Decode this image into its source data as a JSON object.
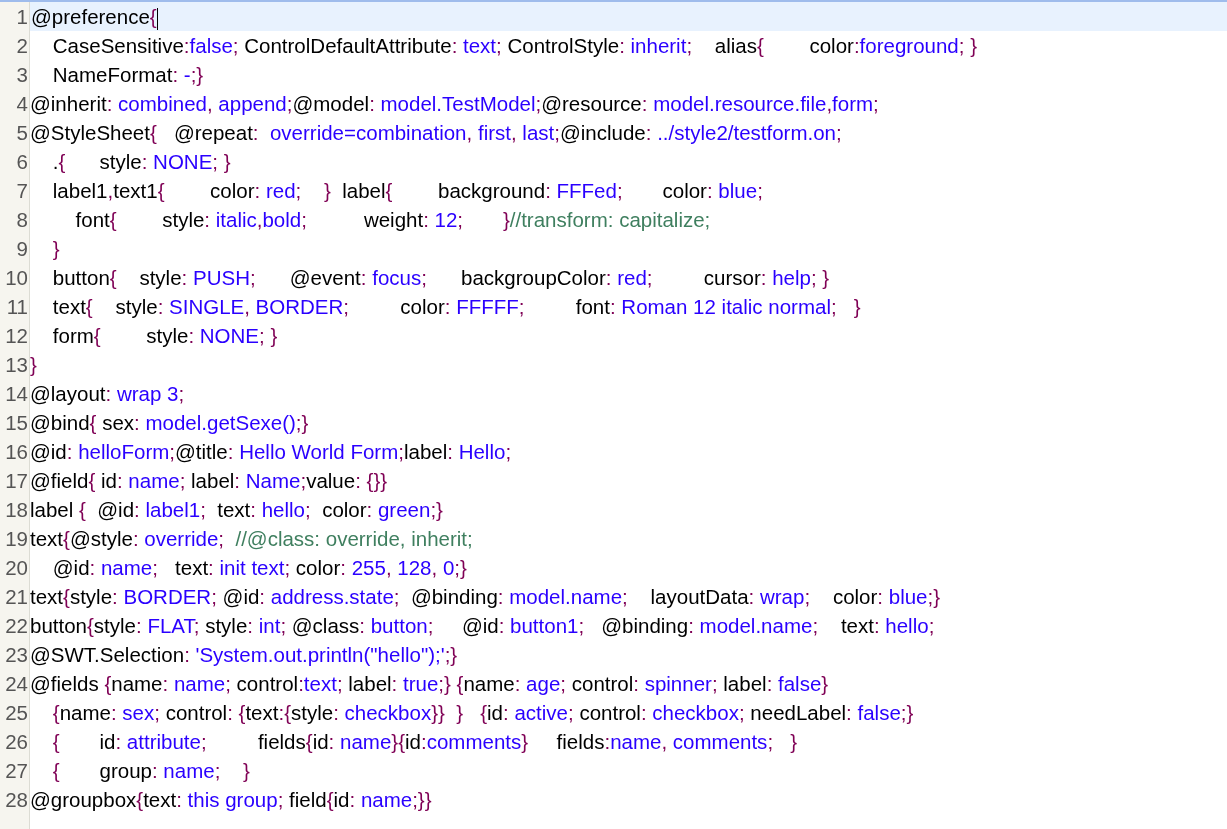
{
  "editor": {
    "lines": [
      {
        "number": "1",
        "current": true,
        "tokens": [
          {
            "kind": "plain",
            "text": "@preference"
          },
          {
            "kind": "punct",
            "text": "{"
          }
        ]
      },
      {
        "number": "2",
        "current": false,
        "tokens": [
          {
            "kind": "plain",
            "text": "    CaseSensitive"
          },
          {
            "kind": "punct",
            "text": ":"
          },
          {
            "kind": "value",
            "text": "false"
          },
          {
            "kind": "punct",
            "text": ";"
          },
          {
            "kind": "plain",
            "text": " ControlDefaultAttribute"
          },
          {
            "kind": "punct",
            "text": ":"
          },
          {
            "kind": "value",
            "text": " text"
          },
          {
            "kind": "punct",
            "text": ";"
          },
          {
            "kind": "plain",
            "text": " ControlStyle"
          },
          {
            "kind": "punct",
            "text": ":"
          },
          {
            "kind": "value",
            "text": " inherit"
          },
          {
            "kind": "punct",
            "text": ";"
          },
          {
            "kind": "plain",
            "text": "    alias"
          },
          {
            "kind": "punct",
            "text": "{"
          },
          {
            "kind": "plain",
            "text": "        color"
          },
          {
            "kind": "punct",
            "text": ":"
          },
          {
            "kind": "value",
            "text": "foreground"
          },
          {
            "kind": "punct",
            "text": "; }"
          }
        ]
      },
      {
        "number": "3",
        "current": false,
        "tokens": [
          {
            "kind": "plain",
            "text": "    NameFormat"
          },
          {
            "kind": "punct",
            "text": ":"
          },
          {
            "kind": "value",
            "text": " -"
          },
          {
            "kind": "punct",
            "text": ";}"
          }
        ]
      },
      {
        "number": "4",
        "current": false,
        "tokens": [
          {
            "kind": "plain",
            "text": "@inherit"
          },
          {
            "kind": "punct",
            "text": ":"
          },
          {
            "kind": "value",
            "text": " combined"
          },
          {
            "kind": "punct",
            "text": ","
          },
          {
            "kind": "value",
            "text": " append"
          },
          {
            "kind": "punct",
            "text": ";"
          },
          {
            "kind": "plain",
            "text": "@model"
          },
          {
            "kind": "punct",
            "text": ":"
          },
          {
            "kind": "value",
            "text": " model.TestModel"
          },
          {
            "kind": "punct",
            "text": ";"
          },
          {
            "kind": "plain",
            "text": "@resource"
          },
          {
            "kind": "punct",
            "text": ":"
          },
          {
            "kind": "value",
            "text": " model.resource.file"
          },
          {
            "kind": "punct",
            "text": ","
          },
          {
            "kind": "value",
            "text": "form"
          },
          {
            "kind": "punct",
            "text": ";"
          }
        ]
      },
      {
        "number": "5",
        "current": false,
        "tokens": [
          {
            "kind": "plain",
            "text": "@StyleSheet"
          },
          {
            "kind": "punct",
            "text": "{"
          },
          {
            "kind": "plain",
            "text": "   @repeat"
          },
          {
            "kind": "punct",
            "text": ":"
          },
          {
            "kind": "value",
            "text": "  override=combination"
          },
          {
            "kind": "punct",
            "text": ","
          },
          {
            "kind": "value",
            "text": " first"
          },
          {
            "kind": "punct",
            "text": ","
          },
          {
            "kind": "value",
            "text": " last"
          },
          {
            "kind": "punct",
            "text": ";"
          },
          {
            "kind": "plain",
            "text": "@include"
          },
          {
            "kind": "punct",
            "text": ":"
          },
          {
            "kind": "value",
            "text": " ../style2/testform.on"
          },
          {
            "kind": "punct",
            "text": ";"
          }
        ]
      },
      {
        "number": "6",
        "current": false,
        "tokens": [
          {
            "kind": "plain",
            "text": "    ."
          },
          {
            "kind": "punct",
            "text": "{"
          },
          {
            "kind": "plain",
            "text": "      style"
          },
          {
            "kind": "punct",
            "text": ":"
          },
          {
            "kind": "value",
            "text": " NONE"
          },
          {
            "kind": "punct",
            "text": "; }"
          }
        ]
      },
      {
        "number": "7",
        "current": false,
        "tokens": [
          {
            "kind": "plain",
            "text": "    label1"
          },
          {
            "kind": "punct",
            "text": ","
          },
          {
            "kind": "plain",
            "text": "text1"
          },
          {
            "kind": "punct",
            "text": "{"
          },
          {
            "kind": "plain",
            "text": "        color"
          },
          {
            "kind": "punct",
            "text": ":"
          },
          {
            "kind": "value",
            "text": " red"
          },
          {
            "kind": "punct",
            "text": ";    }"
          },
          {
            "kind": "plain",
            "text": "  label"
          },
          {
            "kind": "punct",
            "text": "{"
          },
          {
            "kind": "plain",
            "text": "        background"
          },
          {
            "kind": "punct",
            "text": ":"
          },
          {
            "kind": "value",
            "text": " FFFed"
          },
          {
            "kind": "punct",
            "text": ";"
          },
          {
            "kind": "plain",
            "text": "       color"
          },
          {
            "kind": "punct",
            "text": ":"
          },
          {
            "kind": "value",
            "text": " blue"
          },
          {
            "kind": "punct",
            "text": ";"
          }
        ]
      },
      {
        "number": "8",
        "current": false,
        "tokens": [
          {
            "kind": "plain",
            "text": "        font"
          },
          {
            "kind": "punct",
            "text": "{"
          },
          {
            "kind": "plain",
            "text": "        style"
          },
          {
            "kind": "punct",
            "text": ":"
          },
          {
            "kind": "value",
            "text": " italic"
          },
          {
            "kind": "punct",
            "text": ","
          },
          {
            "kind": "value",
            "text": "bold"
          },
          {
            "kind": "punct",
            "text": ";"
          },
          {
            "kind": "plain",
            "text": "          weight"
          },
          {
            "kind": "punct",
            "text": ":"
          },
          {
            "kind": "value",
            "text": " 12"
          },
          {
            "kind": "punct",
            "text": ";       }"
          },
          {
            "kind": "comment",
            "text": "//transform: capitalize;"
          }
        ]
      },
      {
        "number": "9",
        "current": false,
        "tokens": [
          {
            "kind": "punct",
            "text": "    }"
          }
        ]
      },
      {
        "number": "10",
        "current": false,
        "tokens": [
          {
            "kind": "plain",
            "text": "    button"
          },
          {
            "kind": "punct",
            "text": "{"
          },
          {
            "kind": "plain",
            "text": "    style"
          },
          {
            "kind": "punct",
            "text": ":"
          },
          {
            "kind": "value",
            "text": " PUSH"
          },
          {
            "kind": "punct",
            "text": ";"
          },
          {
            "kind": "plain",
            "text": "      @event"
          },
          {
            "kind": "punct",
            "text": ":"
          },
          {
            "kind": "value",
            "text": " focus"
          },
          {
            "kind": "punct",
            "text": ";"
          },
          {
            "kind": "plain",
            "text": "      backgroupColor"
          },
          {
            "kind": "punct",
            "text": ":"
          },
          {
            "kind": "value",
            "text": " red"
          },
          {
            "kind": "punct",
            "text": ";"
          },
          {
            "kind": "plain",
            "text": "         cursor"
          },
          {
            "kind": "punct",
            "text": ":"
          },
          {
            "kind": "value",
            "text": " help"
          },
          {
            "kind": "punct",
            "text": "; }"
          }
        ]
      },
      {
        "number": "11",
        "current": false,
        "tokens": [
          {
            "kind": "plain",
            "text": "    text"
          },
          {
            "kind": "punct",
            "text": "{"
          },
          {
            "kind": "plain",
            "text": "    style"
          },
          {
            "kind": "punct",
            "text": ":"
          },
          {
            "kind": "value",
            "text": " SINGLE"
          },
          {
            "kind": "punct",
            "text": ","
          },
          {
            "kind": "value",
            "text": " BORDER"
          },
          {
            "kind": "punct",
            "text": ";"
          },
          {
            "kind": "plain",
            "text": "         color"
          },
          {
            "kind": "punct",
            "text": ":"
          },
          {
            "kind": "value",
            "text": " FFFFF"
          },
          {
            "kind": "punct",
            "text": ";"
          },
          {
            "kind": "plain",
            "text": "         font"
          },
          {
            "kind": "punct",
            "text": ":"
          },
          {
            "kind": "value",
            "text": " Roman 12 italic normal"
          },
          {
            "kind": "punct",
            "text": ";   }"
          }
        ]
      },
      {
        "number": "12",
        "current": false,
        "tokens": [
          {
            "kind": "plain",
            "text": "    form"
          },
          {
            "kind": "punct",
            "text": "{"
          },
          {
            "kind": "plain",
            "text": "        style"
          },
          {
            "kind": "punct",
            "text": ":"
          },
          {
            "kind": "value",
            "text": " NONE"
          },
          {
            "kind": "punct",
            "text": "; }"
          }
        ]
      },
      {
        "number": "13",
        "current": false,
        "tokens": [
          {
            "kind": "punct",
            "text": "}"
          }
        ]
      },
      {
        "number": "14",
        "current": false,
        "tokens": [
          {
            "kind": "plain",
            "text": "@layout"
          },
          {
            "kind": "punct",
            "text": ":"
          },
          {
            "kind": "value",
            "text": " wrap 3"
          },
          {
            "kind": "punct",
            "text": ";"
          }
        ]
      },
      {
        "number": "15",
        "current": false,
        "tokens": [
          {
            "kind": "plain",
            "text": "@bind"
          },
          {
            "kind": "punct",
            "text": "{"
          },
          {
            "kind": "plain",
            "text": " sex"
          },
          {
            "kind": "punct",
            "text": ":"
          },
          {
            "kind": "value",
            "text": " model.getSexe()"
          },
          {
            "kind": "punct",
            "text": ";}"
          }
        ]
      },
      {
        "number": "16",
        "current": false,
        "tokens": [
          {
            "kind": "plain",
            "text": "@id"
          },
          {
            "kind": "punct",
            "text": ":"
          },
          {
            "kind": "value",
            "text": " helloForm"
          },
          {
            "kind": "punct",
            "text": ";"
          },
          {
            "kind": "plain",
            "text": "@title"
          },
          {
            "kind": "punct",
            "text": ":"
          },
          {
            "kind": "value",
            "text": " Hello World Form"
          },
          {
            "kind": "punct",
            "text": ";"
          },
          {
            "kind": "plain",
            "text": "label"
          },
          {
            "kind": "punct",
            "text": ":"
          },
          {
            "kind": "value",
            "text": " Hello"
          },
          {
            "kind": "punct",
            "text": ";"
          }
        ]
      },
      {
        "number": "17",
        "current": false,
        "tokens": [
          {
            "kind": "plain",
            "text": "@field"
          },
          {
            "kind": "punct",
            "text": "{"
          },
          {
            "kind": "plain",
            "text": " id"
          },
          {
            "kind": "punct",
            "text": ":"
          },
          {
            "kind": "value",
            "text": " name"
          },
          {
            "kind": "punct",
            "text": ";"
          },
          {
            "kind": "plain",
            "text": " label"
          },
          {
            "kind": "punct",
            "text": ":"
          },
          {
            "kind": "value",
            "text": " Name"
          },
          {
            "kind": "punct",
            "text": ";"
          },
          {
            "kind": "plain",
            "text": "value"
          },
          {
            "kind": "punct",
            "text": ": {}}"
          }
        ]
      },
      {
        "number": "18",
        "current": false,
        "tokens": [
          {
            "kind": "plain",
            "text": "label "
          },
          {
            "kind": "punct",
            "text": "{"
          },
          {
            "kind": "plain",
            "text": "  @id"
          },
          {
            "kind": "punct",
            "text": ":"
          },
          {
            "kind": "value",
            "text": " label1"
          },
          {
            "kind": "punct",
            "text": ";"
          },
          {
            "kind": "plain",
            "text": "  text"
          },
          {
            "kind": "punct",
            "text": ":"
          },
          {
            "kind": "value",
            "text": " hello"
          },
          {
            "kind": "punct",
            "text": ";"
          },
          {
            "kind": "plain",
            "text": "  color"
          },
          {
            "kind": "punct",
            "text": ":"
          },
          {
            "kind": "value",
            "text": " green"
          },
          {
            "kind": "punct",
            "text": ";}"
          }
        ]
      },
      {
        "number": "19",
        "current": false,
        "tokens": [
          {
            "kind": "plain",
            "text": "text"
          },
          {
            "kind": "punct",
            "text": "{"
          },
          {
            "kind": "plain",
            "text": "@style"
          },
          {
            "kind": "punct",
            "text": ":"
          },
          {
            "kind": "value",
            "text": " override"
          },
          {
            "kind": "punct",
            "text": ";"
          },
          {
            "kind": "comment",
            "text": "  //@class: override, inherit;"
          }
        ]
      },
      {
        "number": "20",
        "current": false,
        "tokens": [
          {
            "kind": "plain",
            "text": "    @id"
          },
          {
            "kind": "punct",
            "text": ":"
          },
          {
            "kind": "value",
            "text": " name"
          },
          {
            "kind": "punct",
            "text": ";"
          },
          {
            "kind": "plain",
            "text": "   text"
          },
          {
            "kind": "punct",
            "text": ":"
          },
          {
            "kind": "value",
            "text": " init text"
          },
          {
            "kind": "punct",
            "text": ";"
          },
          {
            "kind": "plain",
            "text": " color"
          },
          {
            "kind": "punct",
            "text": ":"
          },
          {
            "kind": "value",
            "text": " 255"
          },
          {
            "kind": "punct",
            "text": ","
          },
          {
            "kind": "value",
            "text": " 128"
          },
          {
            "kind": "punct",
            "text": ","
          },
          {
            "kind": "value",
            "text": " 0"
          },
          {
            "kind": "punct",
            "text": ";}"
          }
        ]
      },
      {
        "number": "21",
        "current": false,
        "tokens": [
          {
            "kind": "plain",
            "text": "text"
          },
          {
            "kind": "punct",
            "text": "{"
          },
          {
            "kind": "plain",
            "text": "style"
          },
          {
            "kind": "punct",
            "text": ":"
          },
          {
            "kind": "value",
            "text": " BORDER"
          },
          {
            "kind": "punct",
            "text": ";"
          },
          {
            "kind": "plain",
            "text": " @id"
          },
          {
            "kind": "punct",
            "text": ":"
          },
          {
            "kind": "value",
            "text": " address.state"
          },
          {
            "kind": "punct",
            "text": ";"
          },
          {
            "kind": "plain",
            "text": "  @binding"
          },
          {
            "kind": "punct",
            "text": ":"
          },
          {
            "kind": "value",
            "text": " model.name"
          },
          {
            "kind": "punct",
            "text": ";"
          },
          {
            "kind": "plain",
            "text": "    layoutData"
          },
          {
            "kind": "punct",
            "text": ":"
          },
          {
            "kind": "value",
            "text": " wrap"
          },
          {
            "kind": "punct",
            "text": ";"
          },
          {
            "kind": "plain",
            "text": "    color"
          },
          {
            "kind": "punct",
            "text": ":"
          },
          {
            "kind": "value",
            "text": " blue"
          },
          {
            "kind": "punct",
            "text": ";}"
          }
        ]
      },
      {
        "number": "22",
        "current": false,
        "tokens": [
          {
            "kind": "plain",
            "text": "button"
          },
          {
            "kind": "punct",
            "text": "{"
          },
          {
            "kind": "plain",
            "text": "style"
          },
          {
            "kind": "punct",
            "text": ":"
          },
          {
            "kind": "value",
            "text": " FLAT"
          },
          {
            "kind": "punct",
            "text": ";"
          },
          {
            "kind": "plain",
            "text": " style"
          },
          {
            "kind": "punct",
            "text": ":"
          },
          {
            "kind": "value",
            "text": " int"
          },
          {
            "kind": "punct",
            "text": ";"
          },
          {
            "kind": "plain",
            "text": " @class"
          },
          {
            "kind": "punct",
            "text": ":"
          },
          {
            "kind": "value",
            "text": " button"
          },
          {
            "kind": "punct",
            "text": ";"
          },
          {
            "kind": "plain",
            "text": "     @id"
          },
          {
            "kind": "punct",
            "text": ":"
          },
          {
            "kind": "value",
            "text": " button1"
          },
          {
            "kind": "punct",
            "text": ";"
          },
          {
            "kind": "plain",
            "text": "   @binding"
          },
          {
            "kind": "punct",
            "text": ":"
          },
          {
            "kind": "value",
            "text": " model.name"
          },
          {
            "kind": "punct",
            "text": ";"
          },
          {
            "kind": "plain",
            "text": "    text"
          },
          {
            "kind": "punct",
            "text": ":"
          },
          {
            "kind": "value",
            "text": " hello"
          },
          {
            "kind": "punct",
            "text": ";"
          }
        ]
      },
      {
        "number": "23",
        "current": false,
        "tokens": [
          {
            "kind": "plain",
            "text": "@SWT.Selection"
          },
          {
            "kind": "punct",
            "text": ":"
          },
          {
            "kind": "value",
            "text": " 'System.out.println(\"hello\");'"
          },
          {
            "kind": "punct",
            "text": ";}"
          }
        ]
      },
      {
        "number": "24",
        "current": false,
        "tokens": [
          {
            "kind": "plain",
            "text": "@fields "
          },
          {
            "kind": "punct",
            "text": "{"
          },
          {
            "kind": "plain",
            "text": "name"
          },
          {
            "kind": "punct",
            "text": ":"
          },
          {
            "kind": "value",
            "text": " name"
          },
          {
            "kind": "punct",
            "text": ";"
          },
          {
            "kind": "plain",
            "text": " control"
          },
          {
            "kind": "punct",
            "text": ":"
          },
          {
            "kind": "value",
            "text": "text"
          },
          {
            "kind": "punct",
            "text": ";"
          },
          {
            "kind": "plain",
            "text": " label"
          },
          {
            "kind": "punct",
            "text": ":"
          },
          {
            "kind": "value",
            "text": " true"
          },
          {
            "kind": "punct",
            "text": ";} {"
          },
          {
            "kind": "plain",
            "text": "name"
          },
          {
            "kind": "punct",
            "text": ":"
          },
          {
            "kind": "value",
            "text": " age"
          },
          {
            "kind": "punct",
            "text": ";"
          },
          {
            "kind": "plain",
            "text": " control"
          },
          {
            "kind": "punct",
            "text": ":"
          },
          {
            "kind": "value",
            "text": " spinner"
          },
          {
            "kind": "punct",
            "text": ";"
          },
          {
            "kind": "plain",
            "text": " label"
          },
          {
            "kind": "punct",
            "text": ":"
          },
          {
            "kind": "value",
            "text": " false"
          },
          {
            "kind": "punct",
            "text": "}"
          }
        ]
      },
      {
        "number": "25",
        "current": false,
        "tokens": [
          {
            "kind": "punct",
            "text": "    {"
          },
          {
            "kind": "plain",
            "text": "name"
          },
          {
            "kind": "punct",
            "text": ":"
          },
          {
            "kind": "value",
            "text": " sex"
          },
          {
            "kind": "punct",
            "text": ";"
          },
          {
            "kind": "plain",
            "text": " control"
          },
          {
            "kind": "punct",
            "text": ": {"
          },
          {
            "kind": "plain",
            "text": "text"
          },
          {
            "kind": "punct",
            "text": ":{"
          },
          {
            "kind": "plain",
            "text": "style"
          },
          {
            "kind": "punct",
            "text": ":"
          },
          {
            "kind": "value",
            "text": " checkbox"
          },
          {
            "kind": "punct",
            "text": "}}  }   {"
          },
          {
            "kind": "plain",
            "text": "id"
          },
          {
            "kind": "punct",
            "text": ":"
          },
          {
            "kind": "value",
            "text": " active"
          },
          {
            "kind": "punct",
            "text": ";"
          },
          {
            "kind": "plain",
            "text": " control"
          },
          {
            "kind": "punct",
            "text": ":"
          },
          {
            "kind": "value",
            "text": " checkbox"
          },
          {
            "kind": "punct",
            "text": ";"
          },
          {
            "kind": "plain",
            "text": " needLabel"
          },
          {
            "kind": "punct",
            "text": ":"
          },
          {
            "kind": "value",
            "text": " false"
          },
          {
            "kind": "punct",
            "text": ";}"
          }
        ]
      },
      {
        "number": "26",
        "current": false,
        "tokens": [
          {
            "kind": "punct",
            "text": "    {"
          },
          {
            "kind": "plain",
            "text": "       id"
          },
          {
            "kind": "punct",
            "text": ":"
          },
          {
            "kind": "value",
            "text": " attribute"
          },
          {
            "kind": "punct",
            "text": ";"
          },
          {
            "kind": "plain",
            "text": "         fields"
          },
          {
            "kind": "punct",
            "text": "{"
          },
          {
            "kind": "plain",
            "text": "id"
          },
          {
            "kind": "punct",
            "text": ":"
          },
          {
            "kind": "value",
            "text": " name"
          },
          {
            "kind": "punct",
            "text": "}{"
          },
          {
            "kind": "plain",
            "text": "id"
          },
          {
            "kind": "punct",
            "text": ":"
          },
          {
            "kind": "value",
            "text": "comments"
          },
          {
            "kind": "punct",
            "text": "}"
          },
          {
            "kind": "plain",
            "text": "     fields"
          },
          {
            "kind": "punct",
            "text": ":"
          },
          {
            "kind": "value",
            "text": "name"
          },
          {
            "kind": "punct",
            "text": ","
          },
          {
            "kind": "value",
            "text": " comments"
          },
          {
            "kind": "punct",
            "text": ";   }"
          }
        ]
      },
      {
        "number": "27",
        "current": false,
        "tokens": [
          {
            "kind": "punct",
            "text": "    {"
          },
          {
            "kind": "plain",
            "text": "       group"
          },
          {
            "kind": "punct",
            "text": ":"
          },
          {
            "kind": "value",
            "text": " name"
          },
          {
            "kind": "punct",
            "text": ";    }"
          }
        ]
      },
      {
        "number": "28",
        "current": false,
        "tokens": [
          {
            "kind": "plain",
            "text": "@groupbox"
          },
          {
            "kind": "punct",
            "text": "{"
          },
          {
            "kind": "plain",
            "text": "text"
          },
          {
            "kind": "punct",
            "text": ":"
          },
          {
            "kind": "value",
            "text": " this group"
          },
          {
            "kind": "punct",
            "text": ";"
          },
          {
            "kind": "plain",
            "text": " field"
          },
          {
            "kind": "punct",
            "text": "{"
          },
          {
            "kind": "plain",
            "text": "id"
          },
          {
            "kind": "punct",
            "text": ":"
          },
          {
            "kind": "value",
            "text": " name"
          },
          {
            "kind": "punct",
            "text": ";}}"
          }
        ]
      }
    ]
  }
}
